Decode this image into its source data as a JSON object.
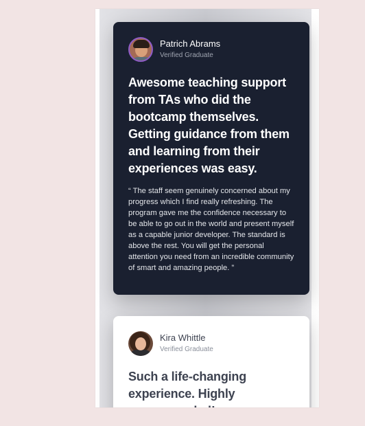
{
  "testimonials": [
    {
      "name": "Patrich Abrams",
      "role": "Verified Graduate",
      "headline": "Awesome teaching support from TAs who did the bootcamp themselves. Getting guidance from them and learning from their experiences was easy.",
      "quote": "“ The staff seem genuinely concerned about my progress which I find really refreshing. The program gave me the confidence necessary to be able to go out in the world and present myself as a capable junior developer. The standard is above the rest. You will get the personal attention you need from an incredible community of smart and amazing people. ”"
    },
    {
      "name": "Kira Whittle",
      "role": "Verified Graduate",
      "headline": "Such a life-changing experience. Highly recommended!"
    }
  ],
  "colors": {
    "page_bg": "#f2e4e4",
    "dark_card": "#1a2030",
    "light_card": "#ffffff",
    "avatar_ring": "#8e5bc7"
  }
}
